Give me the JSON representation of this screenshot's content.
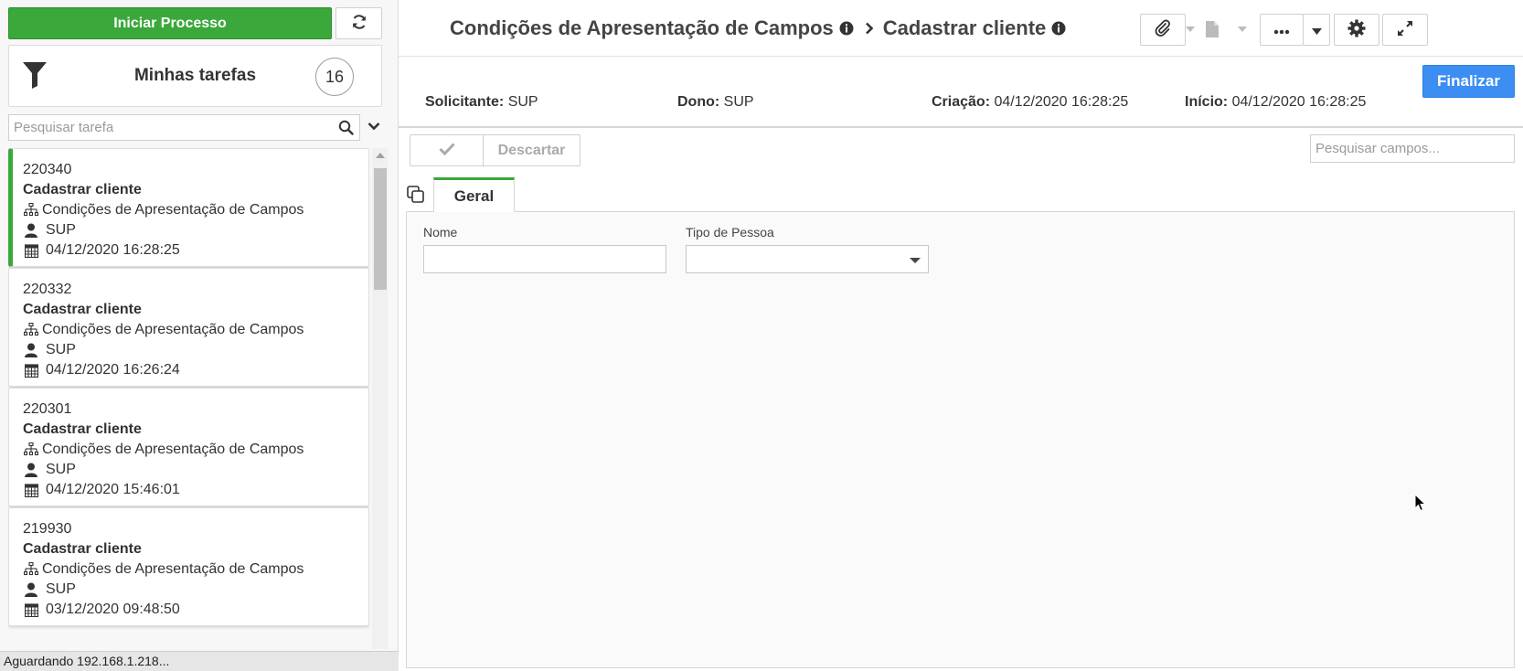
{
  "sidebar": {
    "start_button": "Iniciar Processo",
    "tasks_title": "Minhas tarefas",
    "tasks_count": "16",
    "search_placeholder": "Pesquisar tarefa",
    "tasks": [
      {
        "id": "220340",
        "title": "Cadastrar cliente",
        "process": "Condições de Apresentação de Campos",
        "user": "SUP",
        "date": "04/12/2020 16:28:25",
        "active": true
      },
      {
        "id": "220332",
        "title": "Cadastrar cliente",
        "process": "Condições de Apresentação de Campos",
        "user": "SUP",
        "date": "04/12/2020 16:26:24",
        "active": false
      },
      {
        "id": "220301",
        "title": "Cadastrar cliente",
        "process": "Condições de Apresentação de Campos",
        "user": "SUP",
        "date": "04/12/2020 15:46:01",
        "active": false
      },
      {
        "id": "219930",
        "title": "Cadastrar cliente",
        "process": "Condições de Apresentação de Campos",
        "user": "SUP",
        "date": "03/12/2020 09:48:50",
        "active": false
      }
    ]
  },
  "status_bar": "Aguardando 192.168.1.218...",
  "header": {
    "process_name": "Condições de Apresentação de Campos",
    "task_name": "Cadastrar cliente"
  },
  "toolbar": {
    "finalize_label": "Finalizar"
  },
  "meta": {
    "requester_label": "Solicitante:",
    "requester_value": "SUP",
    "owner_label": "Dono:",
    "owner_value": "SUP",
    "created_label": "Criação:",
    "created_value": "04/12/2020 16:28:25",
    "start_label": "Início:",
    "start_value": "04/12/2020 16:28:25"
  },
  "actions": {
    "discard_label": "Descartar",
    "search_fields_placeholder": "Pesquisar campos..."
  },
  "tabs": [
    {
      "label": "Geral",
      "active": true
    }
  ],
  "form": {
    "fields": [
      {
        "label": "Nome",
        "value": ""
      },
      {
        "label": "Tipo de Pessoa",
        "value": ""
      }
    ]
  },
  "colors": {
    "accent_green": "#3aa83a",
    "primary_blue": "#3d8ef2"
  }
}
